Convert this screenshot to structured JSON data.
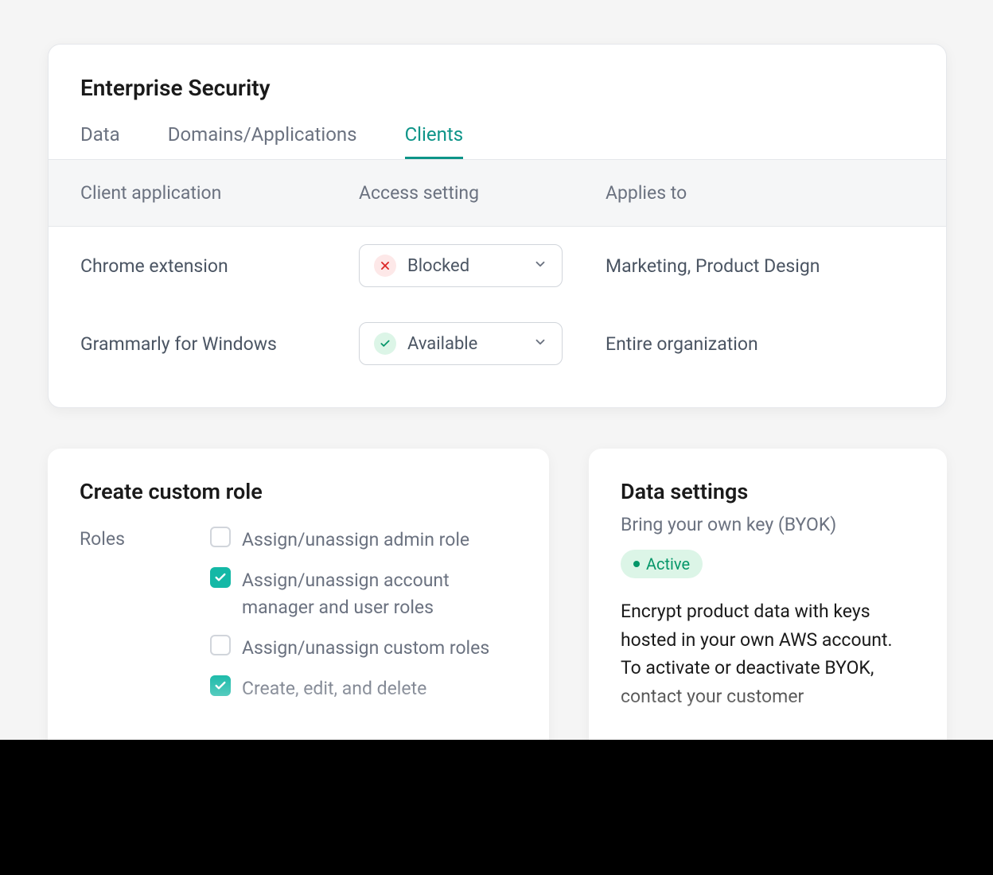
{
  "enterprise": {
    "title": "Enterprise Security",
    "tabs": {
      "data": "Data",
      "domains": "Domains/Applications",
      "clients": "Clients"
    },
    "columns": {
      "client_app": "Client application",
      "access": "Access setting",
      "applies": "Applies to"
    },
    "rows": [
      {
        "app": "Chrome extension",
        "status": "Blocked",
        "applies": "Marketing, Product Design"
      },
      {
        "app": "Grammarly for Windows",
        "status": "Available",
        "applies": "Entire organization"
      }
    ]
  },
  "roles_card": {
    "title": "Create custom role",
    "group_label": "Roles",
    "items": [
      {
        "label": "Assign/unassign admin role",
        "checked": false
      },
      {
        "label": "Assign/unassign account manager and user roles",
        "checked": true
      },
      {
        "label": "Assign/unassign custom roles",
        "checked": false
      },
      {
        "label": "Create, edit, and delete",
        "checked": true
      }
    ]
  },
  "data_card": {
    "title": "Data settings",
    "subtitle": "Bring your own key (BYOK)",
    "badge": "Active",
    "description": "Encrypt product data with keys hosted in your own AWS account. To activate or deactivate BYOK, contact your customer"
  }
}
